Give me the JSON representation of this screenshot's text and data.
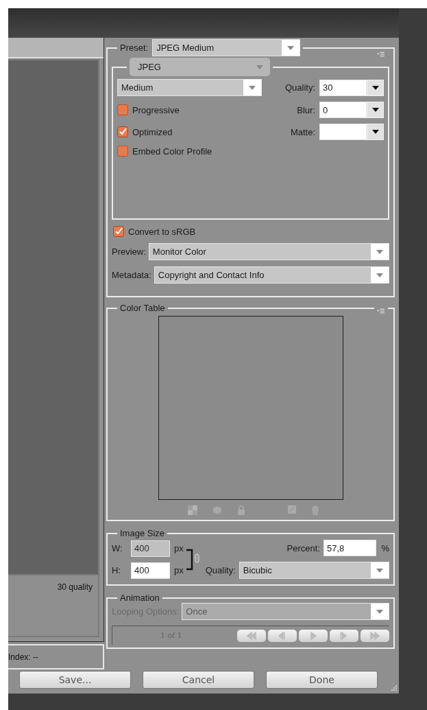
{
  "preview_panel": {
    "info": "30 quality",
    "index": "Index: --"
  },
  "preset": {
    "label": "Preset:",
    "value": "JPEG Medium"
  },
  "format": {
    "value": "JPEG"
  },
  "compression": {
    "value": "Medium"
  },
  "quality": {
    "label": "Quality:",
    "value": "30"
  },
  "blur": {
    "label": "Blur:",
    "value": "0"
  },
  "matte": {
    "label": "Matte:"
  },
  "options": [
    {
      "label": "Progressive",
      "checked": false
    },
    {
      "label": "Optimized",
      "checked": true
    },
    {
      "label": "Embed Color Profile",
      "checked": false
    }
  ],
  "convert_srgb": {
    "label": "Convert to sRGB",
    "checked": true
  },
  "preview": {
    "label": "Preview:",
    "value": "Monitor Color"
  },
  "metadata": {
    "label": "Metadata:",
    "value": "Copyright and Contact Info"
  },
  "color_table": {
    "title": "Color Table"
  },
  "image_size": {
    "title": "Image Size",
    "width": {
      "label": "W:",
      "value": "400",
      "unit": "px",
      "selected": true
    },
    "height": {
      "label": "H:",
      "value": "400",
      "unit": "px",
      "selected": false
    },
    "percent": {
      "label": "Percent:",
      "value": "57,8",
      "unit": "%"
    },
    "quality": {
      "label": "Quality:",
      "value": "Bicubic"
    }
  },
  "animation": {
    "title": "Animation",
    "looping": {
      "label": "Looping Options:",
      "value": "Once",
      "disabled": true
    },
    "frame": "1 of 1"
  },
  "buttons": [
    {
      "label": "Save..."
    },
    {
      "label": "Cancel"
    },
    {
      "label": "Done"
    }
  ]
}
